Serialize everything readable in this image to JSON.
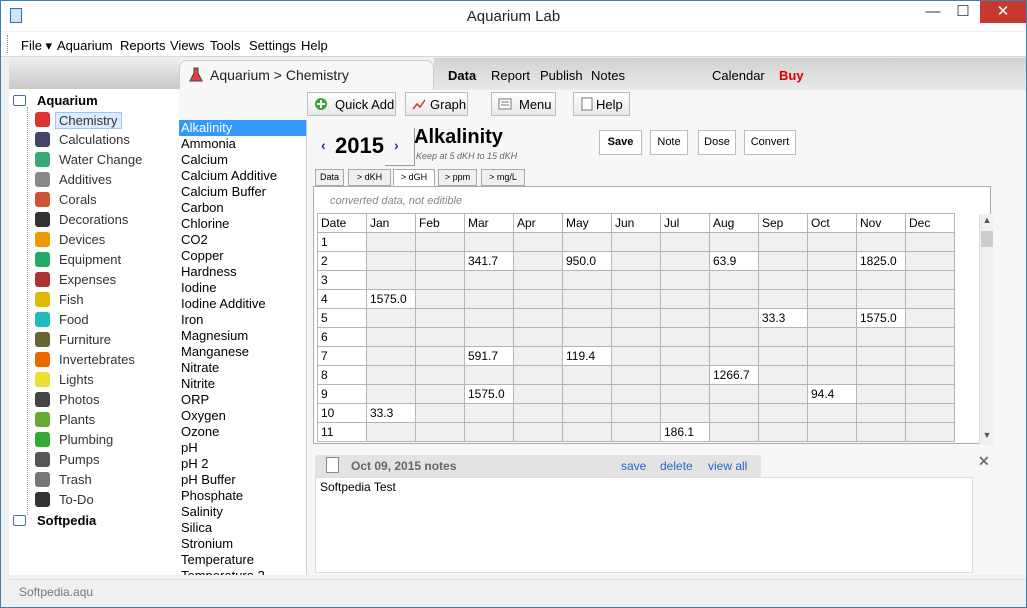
{
  "window": {
    "title": "Aquarium Lab",
    "minimize": "—",
    "maximize": "☐",
    "close": "✕"
  },
  "menu": [
    "File ▾",
    "Aquarium",
    "Reports",
    "Views",
    "Tools",
    "Settings",
    "Help"
  ],
  "sidebar": {
    "category": "Aquarium",
    "category2": "Softpedia",
    "items": [
      {
        "label": "Chemistry",
        "icon": "flask-icon",
        "selected": true
      },
      {
        "label": "Calculations",
        "icon": "calculator-icon"
      },
      {
        "label": "Water Change",
        "icon": "water-change-icon"
      },
      {
        "label": "Additives",
        "icon": "dropper-icon"
      },
      {
        "label": "Corals",
        "icon": "coral-icon"
      },
      {
        "label": "Decorations",
        "icon": "decoration-icon"
      },
      {
        "label": "Devices",
        "icon": "device-icon"
      },
      {
        "label": "Equipment",
        "icon": "equipment-icon"
      },
      {
        "label": "Expenses",
        "icon": "wallet-icon"
      },
      {
        "label": "Fish",
        "icon": "fish-icon"
      },
      {
        "label": "Food",
        "icon": "food-icon"
      },
      {
        "label": "Furniture",
        "icon": "furniture-icon"
      },
      {
        "label": "Invertebrates",
        "icon": "starfish-icon"
      },
      {
        "label": "Lights",
        "icon": "bulb-icon"
      },
      {
        "label": "Photos",
        "icon": "camera-icon"
      },
      {
        "label": "Plants",
        "icon": "plant-icon"
      },
      {
        "label": "Plumbing",
        "icon": "pipe-icon"
      },
      {
        "label": "Pumps",
        "icon": "pump-icon"
      },
      {
        "label": "Trash",
        "icon": "trash-icon"
      },
      {
        "label": "To-Do",
        "icon": "checklist-icon"
      }
    ]
  },
  "breadcrumb": "Aquarium > Chemistry",
  "topnav": {
    "data": "Data",
    "report": "Report",
    "publish": "Publish",
    "notes": "Notes",
    "calendar": "Calendar",
    "buy": "Buy",
    "buy_color": "#d40000"
  },
  "toolbar": {
    "quickadd": "Quick Add",
    "graph": "Graph",
    "menu": "Menu",
    "help": "Help"
  },
  "chemicals": [
    "Alkalinity",
    "Ammonia",
    "Calcium",
    "Calcium Additive",
    "Calcium Buffer",
    "Carbon",
    "Chlorine",
    "CO2",
    "Copper",
    "Hardness",
    "Iodine",
    "Iodine Additive",
    "Iron",
    "Magnesium",
    "Manganese",
    "Nitrate",
    "Nitrite",
    "ORP",
    "Oxygen",
    "Ozone",
    "pH",
    "pH 2",
    "pH Buffer",
    "Phosphate",
    "Salinity",
    "Silica",
    "Stronium",
    "Temperature",
    "Temperature 2"
  ],
  "selected_chemical": "Alkalinity",
  "year": "2015",
  "prev_year": "‹",
  "next_year": "›",
  "chem_title": "Alkalinity",
  "chem_sub": "Keep at 5 dKH to 15 dKH",
  "actions": {
    "save": "Save",
    "note": "Note",
    "dose": "Dose",
    "convert": "Convert"
  },
  "subtabs": [
    "Data",
    "> dKH",
    "> dGH",
    "> ppm",
    "> mg/L"
  ],
  "active_subtab": 2,
  "grid_note": "converted data, not editible",
  "grid": {
    "headers": [
      "Date",
      "Jan",
      "Feb",
      "Mar",
      "Apr",
      "May",
      "Jun",
      "Jul",
      "Aug",
      "Sep",
      "Oct",
      "Nov",
      "Dec"
    ],
    "rows": [
      [
        "1",
        "",
        "",
        "",
        "",
        "",
        "",
        "",
        "",
        "",
        "",
        "",
        ""
      ],
      [
        "2",
        "",
        "",
        "341.7",
        "",
        "950.0",
        "",
        "",
        "63.9",
        "",
        "",
        "1825.0",
        ""
      ],
      [
        "3",
        "",
        "",
        "",
        "",
        "",
        "",
        "",
        "",
        "",
        "",
        "",
        ""
      ],
      [
        "4",
        "1575.0",
        "",
        "",
        "",
        "",
        "",
        "",
        "",
        "",
        "",
        "",
        ""
      ],
      [
        "5",
        "",
        "",
        "",
        "",
        "",
        "",
        "",
        "",
        "33.3",
        "",
        "1575.0",
        ""
      ],
      [
        "6",
        "",
        "",
        "",
        "",
        "",
        "",
        "",
        "",
        "",
        "",
        "",
        ""
      ],
      [
        "7",
        "",
        "",
        "591.7",
        "",
        "119.4",
        "",
        "",
        "",
        "",
        "",
        "",
        ""
      ],
      [
        "8",
        "",
        "",
        "",
        "",
        "",
        "",
        "",
        "1266.7",
        "",
        "",
        "",
        ""
      ],
      [
        "9",
        "",
        "",
        "1575.0",
        "",
        "",
        "",
        "",
        "",
        "",
        "94.4",
        "",
        ""
      ],
      [
        "10",
        "33.3",
        "",
        "",
        "",
        "",
        "",
        "",
        "",
        "",
        "",
        "",
        ""
      ],
      [
        "11",
        "",
        "",
        "",
        "",
        "",
        "",
        "186.1",
        "",
        "",
        "",
        "",
        ""
      ]
    ]
  },
  "notes": {
    "date": "Oct 09, 2015 notes",
    "save": "save",
    "delete": "delete",
    "view_all": "view all",
    "text": "Softpedia Test",
    "close": "✕"
  },
  "status": "Softpedia.aqu"
}
